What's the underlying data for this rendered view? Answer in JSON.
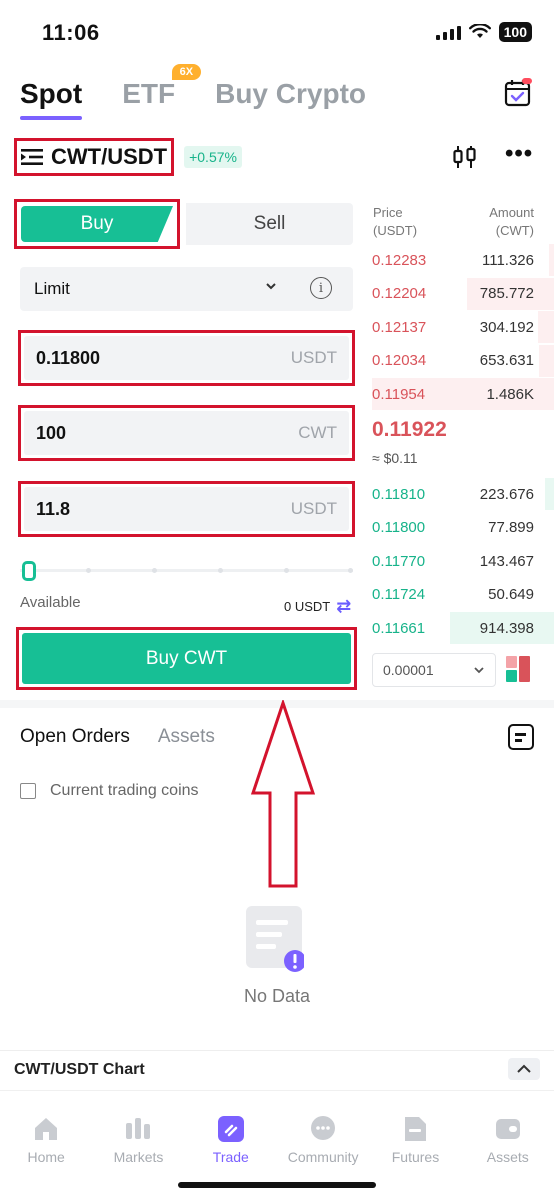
{
  "status_bar": {
    "time": "11:06",
    "battery": "100"
  },
  "top_tabs": [
    {
      "label": "Spot",
      "active": true
    },
    {
      "label": "ETF",
      "badge": "6X"
    },
    {
      "label": "Buy Crypto"
    }
  ],
  "pair": {
    "name": "CWT/USDT",
    "change": "+0.57%"
  },
  "trade_side": {
    "buy": "Buy",
    "sell": "Sell"
  },
  "order_type": "Limit",
  "inputs": {
    "price": {
      "value": "0.11800",
      "unit": "USDT"
    },
    "amount": {
      "value": "100",
      "unit": "CWT"
    },
    "total": {
      "value": "11.8",
      "unit": "USDT"
    }
  },
  "available": {
    "label": "Available",
    "value": "0 USDT"
  },
  "buy_button": "Buy CWT",
  "order_book": {
    "price_header": "Price",
    "price_unit": "(USDT)",
    "amount_header": "Amount",
    "amount_unit": "(CWT)",
    "asks": [
      {
        "price": "0.12283",
        "amount": "111.326",
        "depth": 0.03
      },
      {
        "price": "0.12204",
        "amount": "785.772",
        "depth": 0.48
      },
      {
        "price": "0.12137",
        "amount": "304.192",
        "depth": 0.09
      },
      {
        "price": "0.12034",
        "amount": "653.631",
        "depth": 0.08
      },
      {
        "price": "0.11954",
        "amount": "1.486K",
        "depth": 1.0
      }
    ],
    "mid_price": "0.11922",
    "mid_fiat": "≈ $0.11",
    "bids": [
      {
        "price": "0.11810",
        "amount": "223.676",
        "depth": 0.05
      },
      {
        "price": "0.11800",
        "amount": "77.899",
        "depth": 0.0
      },
      {
        "price": "0.11770",
        "amount": "143.467",
        "depth": 0.0
      },
      {
        "price": "0.11724",
        "amount": "50.649",
        "depth": 0.0
      },
      {
        "price": "0.11661",
        "amount": "914.398",
        "depth": 0.57
      }
    ],
    "precision": "0.00001"
  },
  "orders_section": {
    "tabs": [
      "Open Orders",
      "Assets"
    ],
    "checkbox_label": "Current trading coins",
    "empty_text": "No Data"
  },
  "chart_bar": {
    "label": "CWT/USDT Chart"
  },
  "bottom_nav": [
    {
      "label": "Home",
      "icon": "home-icon"
    },
    {
      "label": "Markets",
      "icon": "markets-icon"
    },
    {
      "label": "Trade",
      "icon": "trade-icon",
      "active": true
    },
    {
      "label": "Community",
      "icon": "community-icon"
    },
    {
      "label": "Futures",
      "icon": "futures-icon"
    },
    {
      "label": "Assets",
      "icon": "wallet-icon"
    }
  ],
  "colors": {
    "buy_green": "#17bf95",
    "sell_red": "#d9535a",
    "accent_purple": "#7b61ff",
    "highlight_red": "#d3132d"
  }
}
